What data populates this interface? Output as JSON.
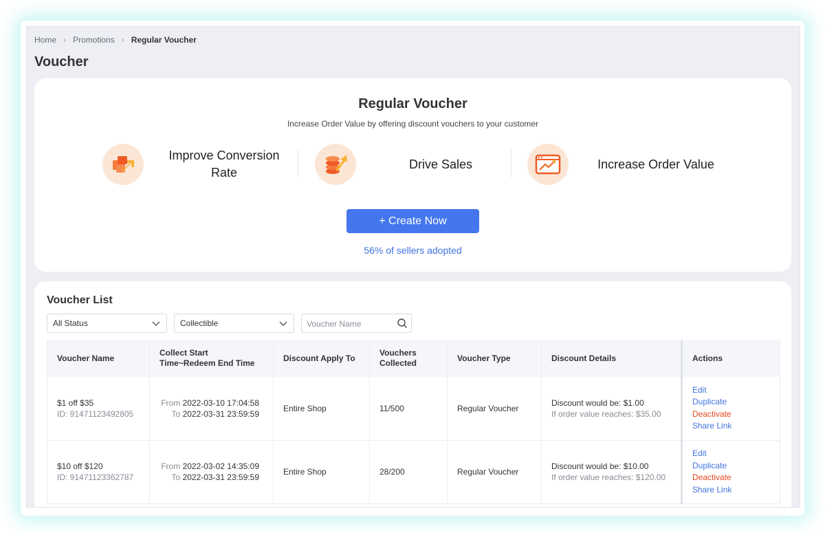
{
  "breadcrumb": [
    "Home",
    "Promotions",
    "Regular Voucher"
  ],
  "page_title": "Voucher",
  "hero": {
    "title": "Regular Voucher",
    "subtitle": "Increase Order Value by offering discount vouchers to your customer",
    "features": [
      {
        "label": "Improve Conversion Rate",
        "icon": "box-arrow-icon"
      },
      {
        "label": "Drive Sales",
        "icon": "coins-arrow-icon"
      },
      {
        "label": "Increase Order Value",
        "icon": "browser-chart-icon"
      }
    ],
    "create_label": "+ Create Now",
    "adopted_text": "56% of sellers adopted"
  },
  "list": {
    "title": "Voucher List",
    "status_filter": "All Status",
    "type_filter": "Collectible",
    "search_placeholder": "Voucher Name",
    "columns": [
      "Voucher Name",
      "Collect Start Time~Redeem End Time",
      "Discount Apply To",
      "Vouchers Collected",
      "Voucher Type",
      "Discount Details",
      "Actions"
    ],
    "from_label": "From",
    "to_label": "To",
    "rows": [
      {
        "name": "$1 off $35",
        "id": "ID: 91471123492805",
        "from": "2022-03-10 17:04:58",
        "to": "2022-03-31 23:59:59",
        "apply_to": "Entire Shop",
        "collected": "11/500",
        "type": "Regular Voucher",
        "discount": "Discount would be: $1.00",
        "condition": "If order value reaches: $35.00"
      },
      {
        "name": "$10 off $120",
        "id": "ID: 91471123362787",
        "from": "2022-03-02 14:35:09",
        "to": "2022-03-31 23:59:59",
        "apply_to": "Entire Shop",
        "collected": "28/200",
        "type": "Regular Voucher",
        "discount": "Discount would be: $10.00",
        "condition": "If order value reaches: $120.00"
      }
    ],
    "actions": [
      "Edit",
      "Duplicate",
      "Deactivate",
      "Share Link"
    ]
  },
  "colors": {
    "accent": "#4477ee",
    "link": "#3f73e0",
    "danger": "#e6461e",
    "icon_bg": "#fbe6d6",
    "icon_orange": "#f47a3c",
    "icon_yellow": "#f9b233"
  }
}
